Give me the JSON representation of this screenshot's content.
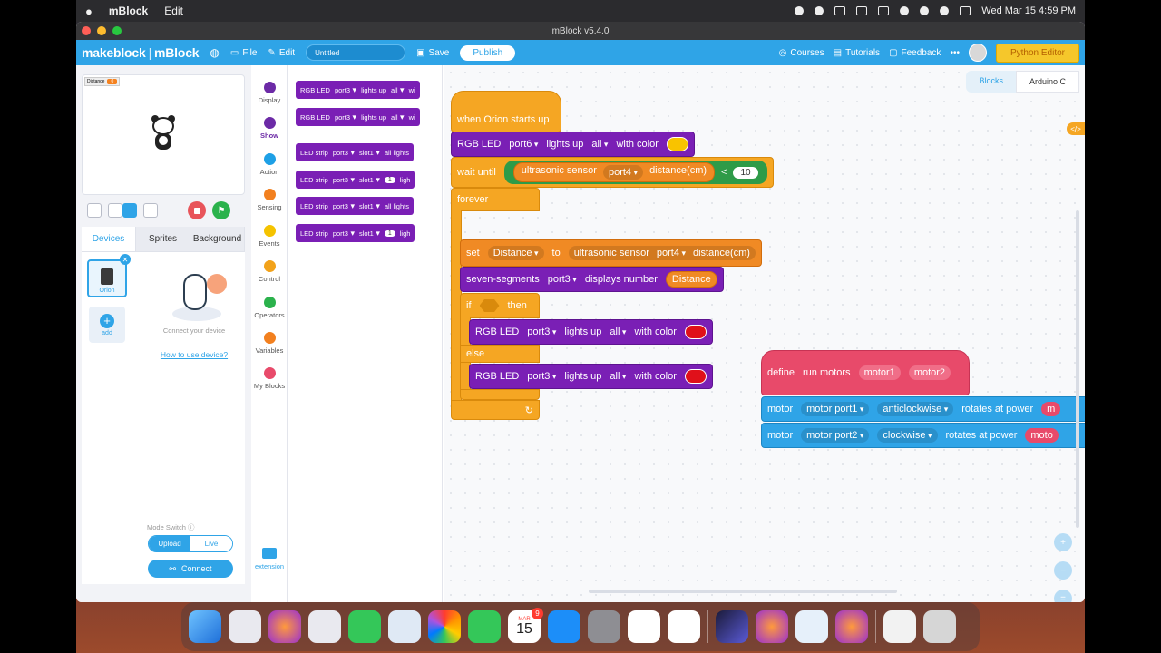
{
  "menubar": {
    "app_name": "mBlock",
    "menu_edit": "Edit",
    "datetime": "Wed Mar 15  4:59 PM"
  },
  "window": {
    "title": "mBlock v5.4.0"
  },
  "topbar": {
    "brand_left": "makeblock",
    "brand_right": "mBlock",
    "file": "File",
    "edit": "Edit",
    "project_name": "Untitled",
    "save": "Save",
    "publish": "Publish",
    "courses": "Courses",
    "tutorials": "Tutorials",
    "feedback": "Feedback",
    "more": "•••",
    "python_editor": "Python Editor"
  },
  "stage": {
    "variable_name": "Distance",
    "variable_value": "0"
  },
  "panel_tabs": [
    "Devices",
    "Sprites",
    "Background"
  ],
  "devices": {
    "device_name": "Orion",
    "add_label": "add",
    "connect_hint": "Connect your device",
    "how_to": "How to use device?",
    "mode_switch_label": "Mode Switch",
    "mode_upload": "Upload",
    "mode_live": "Live",
    "connect": "Connect"
  },
  "categories": [
    {
      "label": "Display",
      "color": "#6c2aa6"
    },
    {
      "label": "Show",
      "color": "#6c2aa6"
    },
    {
      "label": "Action",
      "color": "#1ea0e6"
    },
    {
      "label": "Sensing",
      "color": "#f2801f"
    },
    {
      "label": "Events",
      "color": "#f5c300"
    },
    {
      "label": "Control",
      "color": "#f2a21a"
    },
    {
      "label": "Operators",
      "color": "#2bb24c"
    },
    {
      "label": "Variables",
      "color": "#f2801f"
    },
    {
      "label": "My Blocks",
      "color": "#e84a6a"
    }
  ],
  "extension_label": "extension",
  "palette": [
    {
      "t1": "RGB LED",
      "t2": "port3",
      "t3": "lights up",
      "t4": "all",
      "t5": "wi"
    },
    {
      "t1": "RGB LED",
      "t2": "port3",
      "t3": "lights up",
      "t4": "all",
      "t5": "wi"
    },
    {
      "t1": "LED strip",
      "t2": "port3",
      "t3": "slot1",
      "t4": "all lights",
      "t5": ""
    },
    {
      "t1": "LED strip",
      "t2": "port3",
      "t3": "slot1",
      "t4": "1",
      "t5": "ligh"
    },
    {
      "t1": "LED strip",
      "t2": "port3",
      "t3": "slot1",
      "t4": "all lights",
      "t5": ""
    },
    {
      "t1": "LED strip",
      "t2": "port3",
      "t3": "slot1",
      "t4": "1",
      "t5": "ligh"
    }
  ],
  "view_tabs": {
    "blocks": "Blocks",
    "arduino": "Arduino C"
  },
  "code_toggle": "</>",
  "script": {
    "hat": "when Orion starts up",
    "rgb1": {
      "label": "RGB LED",
      "port": "port6",
      "lights": "lights up",
      "which": "all",
      "with": "with color"
    },
    "wait": {
      "label": "wait until",
      "sensor": "ultrasonic sensor",
      "port": "port4",
      "unit": "distance(cm)",
      "op": "<",
      "value": "10"
    },
    "forever": "forever",
    "set": {
      "label": "set",
      "var": "Distance",
      "to": "to",
      "sensor": "ultrasonic sensor",
      "port": "port4",
      "unit": "distance(cm)"
    },
    "seg": {
      "label": "seven-segments",
      "port": "port3",
      "text": "displays number",
      "var": "Distance"
    },
    "if": {
      "label": "if",
      "then": "then",
      "else": "else"
    },
    "rgb2": {
      "label": "RGB LED",
      "port": "port3",
      "lights": "lights up",
      "which": "all",
      "with": "with color"
    },
    "rgb3": {
      "label": "RGB LED",
      "port": "port3",
      "lights": "lights up",
      "which": "all",
      "with": "with color"
    },
    "define": {
      "label": "define",
      "name": "run motors",
      "arg1": "motor1",
      "arg2": "motor2"
    },
    "motor1": {
      "label": "motor",
      "port": "motor port1",
      "dir": "anticlockwise",
      "text": "rotates at power",
      "arg": "m"
    },
    "motor2": {
      "label": "motor",
      "port": "motor port2",
      "dir": "clockwise",
      "text": "rotates at power",
      "arg": "moto"
    }
  },
  "dock": {
    "calendar_month": "MAR",
    "calendar_day": "15",
    "calendar_badge": "9"
  }
}
